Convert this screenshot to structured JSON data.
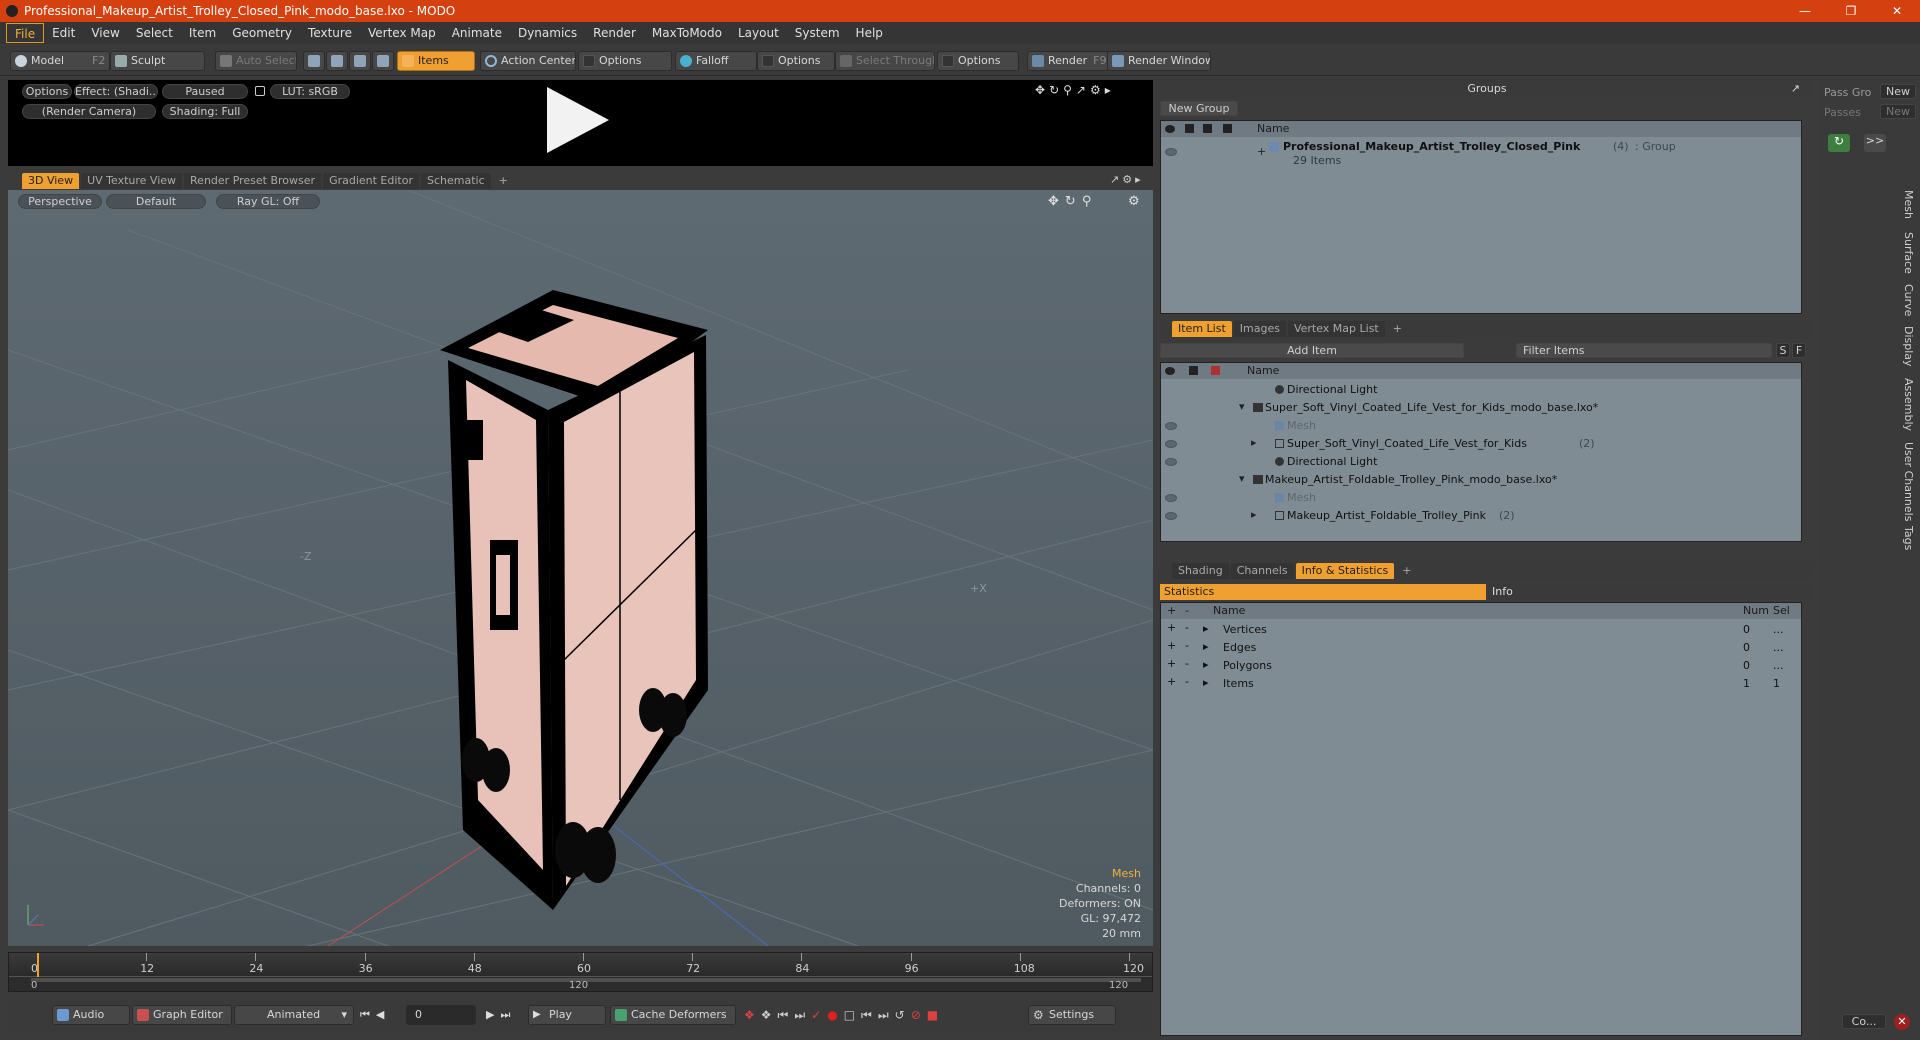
{
  "window": {
    "title": "Professional_Makeup_Artist_Trolley_Closed_Pink_modo_base.lxo - MODO"
  },
  "menu": [
    "File",
    "Edit",
    "View",
    "Select",
    "Item",
    "Geometry",
    "Texture",
    "Vertex Map",
    "Animate",
    "Dynamics",
    "Render",
    "MaxToModo",
    "Layout",
    "System",
    "Help"
  ],
  "toolbar": {
    "model": "Model",
    "model_key": "F2",
    "sculpt": "Sculpt",
    "auto_select": "Auto Select",
    "items": "Items",
    "action_center": "Action Center",
    "options1": "Options",
    "falloff": "Falloff",
    "options2": "Options",
    "select_through": "Select Through",
    "options3": "Options",
    "render": "Render",
    "render_key": "F9",
    "render_window": "Render Window"
  },
  "preview": {
    "options": "Options",
    "effect": "Effect: (Shadi...",
    "paused": "Paused",
    "lut": "LUT: sRGB",
    "camera": "(Render Camera)",
    "shading": "Shading: Full"
  },
  "view_tabs": [
    "3D View",
    "UV Texture View",
    "Render Preset Browser",
    "Gradient Editor",
    "Schematic",
    "+"
  ],
  "viewport": {
    "perspective": "Perspective",
    "default": "Default",
    "raygl": "Ray GL: Off",
    "axis_neg_z": "-Z",
    "axis_pos_x": "+X",
    "info_title": "Mesh",
    "channels": "Channels: 0",
    "deformers": "Deformers: ON",
    "gl": "GL: 97,472",
    "scale": "20 mm"
  },
  "timeline": {
    "ticks": [
      "0",
      "12",
      "24",
      "36",
      "48",
      "60",
      "72",
      "84",
      "96",
      "108",
      "120"
    ],
    "range_start": "0",
    "range_mid": "120",
    "range_end": "120"
  },
  "bottom": {
    "audio": "Audio",
    "graph_editor": "Graph Editor",
    "animated": "Animated",
    "frame": "0",
    "play": "Play",
    "cache": "Cache Deformers",
    "settings": "Settings"
  },
  "groups": {
    "title": "Groups",
    "new_group": "New Group",
    "col_name": "Name",
    "item_name": "Professional_Makeup_Artist_Trolley_Closed_Pink",
    "item_count": "(4)",
    "item_type": ": Group",
    "item_sub": "29 Items"
  },
  "passes": {
    "pass_group": "Pass Gro",
    "new1": "New",
    "passes": "Passes",
    "new2": "New",
    "expand": ">>"
  },
  "item_list": {
    "tabs": [
      "Item List",
      "Images",
      "Vertex Map List",
      "+"
    ],
    "add_item": "Add Item",
    "filter": "Filter Items",
    "s_btn": "S",
    "f_btn": "F",
    "col_name": "Name",
    "rows": [
      {
        "label": "Directional Light",
        "muted": ""
      },
      {
        "label": "Super_Soft_Vinyl_Coated_Life_Vest_for_Kids_modo_base.lxo*",
        "muted": ""
      },
      {
        "label": "Mesh",
        "muted": "1"
      },
      {
        "label": "Super_Soft_Vinyl_Coated_Life_Vest_for_Kids",
        "count": "(2)"
      },
      {
        "label": "Directional Light",
        "muted": ""
      },
      {
        "label": "Makeup_Artist_Foldable_Trolley_Pink_modo_base.lxo*",
        "muted": ""
      },
      {
        "label": "Mesh",
        "muted": "1"
      },
      {
        "label": "Makeup_Artist_Foldable_Trolley_Pink",
        "count": "(2)"
      }
    ]
  },
  "stats": {
    "tabs": [
      "Shading",
      "Channels",
      "Info & Statistics",
      "+"
    ],
    "statistics": "Statistics",
    "info": "Info",
    "col_name": "Name",
    "col_num": "Num",
    "col_sel": "Sel",
    "rows": [
      {
        "name": "Vertices",
        "num": "0",
        "sel": "..."
      },
      {
        "name": "Edges",
        "num": "0",
        "sel": "..."
      },
      {
        "name": "Polygons",
        "num": "0",
        "sel": "..."
      },
      {
        "name": "Items",
        "num": "1",
        "sel": "1"
      }
    ]
  },
  "right_tabs": [
    "Mesh",
    "Surface",
    "Curve",
    "Display",
    "Assembly",
    "User Channels",
    "Tags"
  ],
  "corner_btn": "Co..."
}
